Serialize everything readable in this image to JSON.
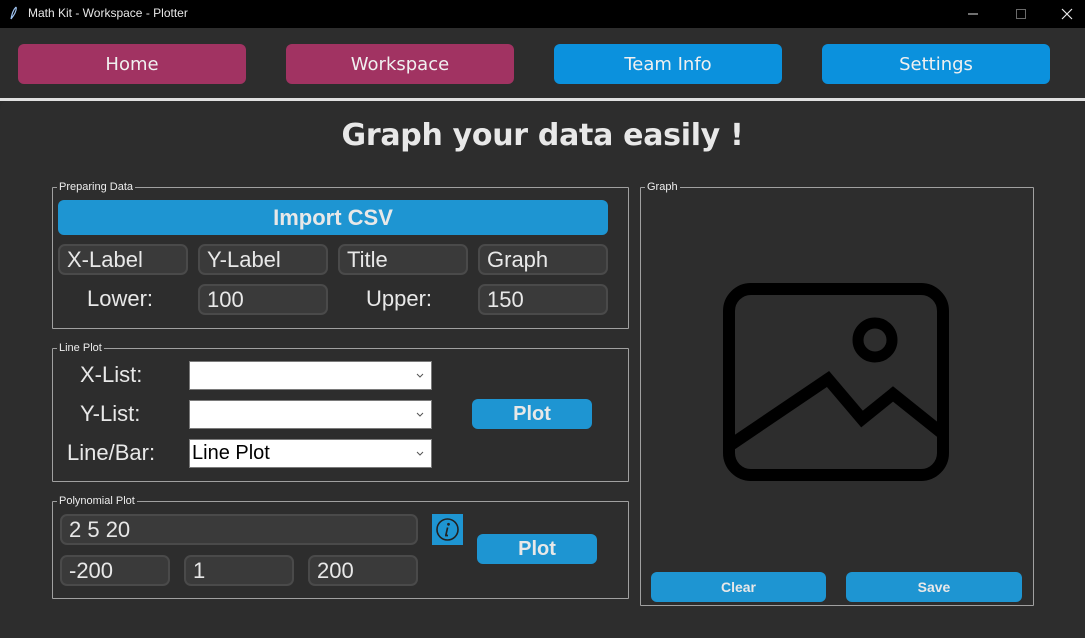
{
  "window": {
    "title": "Math Kit - Workspace - Plotter",
    "controls": [
      "minimize",
      "maximize",
      "close"
    ]
  },
  "nav": {
    "items": [
      {
        "label": "Home",
        "color": "#a13362"
      },
      {
        "label": "Workspace",
        "color": "#a13362"
      },
      {
        "label": "Team Info",
        "color": "#0b91dd"
      },
      {
        "label": "Settings",
        "color": "#0b91dd"
      }
    ]
  },
  "page": {
    "heading": "Graph your data easily !"
  },
  "preparing_data": {
    "group_label": "Preparing Data",
    "import_button": "Import CSV",
    "x_label_field": "X-Label",
    "y_label_field": "Y-Label",
    "title_field": "Title",
    "graph_field": "Graph",
    "lower_label": "Lower:",
    "lower_value": "100",
    "upper_label": "Upper:",
    "upper_value": "150"
  },
  "line_plot": {
    "group_label": "Line Plot",
    "x_list_label": "X-List:",
    "x_list_value": "",
    "y_list_label": "Y-List:",
    "y_list_value": "",
    "line_bar_label": "Line/Bar:",
    "line_bar_value": "Line Plot",
    "plot_button": "Plot"
  },
  "polynomial_plot": {
    "group_label": "Polynomial Plot",
    "coefficients": "2 5 20",
    "range_start": "-200",
    "range_step": "1",
    "range_end": "200",
    "info_icon": "info-icon",
    "plot_button": "Plot"
  },
  "graph": {
    "group_label": "Graph",
    "placeholder_icon": "image-placeholder-icon",
    "clear_button": "Clear",
    "save_button": "Save"
  },
  "colors": {
    "accent_blue": "#1e95d2",
    "nav_blue": "#0b91dd",
    "nav_magenta": "#a13362",
    "background": "#2d2d2d"
  }
}
